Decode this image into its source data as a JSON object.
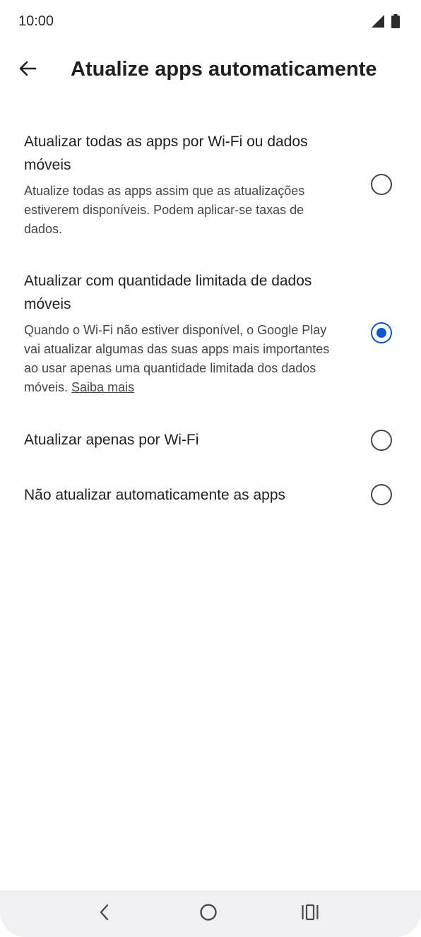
{
  "status_bar": {
    "time": "10:00",
    "icons": [
      "signal-icon",
      "battery-icon"
    ]
  },
  "app_bar": {
    "back_icon": "arrow-left-icon",
    "title": "Atualize apps automaticamente"
  },
  "options": [
    {
      "title": "Atualizar todas as apps por Wi-Fi ou dados móveis",
      "description": "Atualize todas as apps assim que as atualizações estiverem disponíveis. Podem aplicar-se taxas de dados.",
      "selected": false
    },
    {
      "title": "Atualizar com quantidade limitada de dados móveis",
      "description": "Quando o Wi-Fi não estiver disponível, o Google Play vai atualizar algumas das suas apps mais importantes ao usar apenas uma quantidade limitada dos dados móveis.",
      "link": "Saiba mais",
      "selected": true
    },
    {
      "title": "Atualizar apenas por Wi-Fi",
      "selected": false
    },
    {
      "title": "Não atualizar automaticamente as apps",
      "selected": false
    }
  ],
  "colors": {
    "accent": "#0b57d0",
    "text": "#1f1f1f",
    "secondary_text": "#444746",
    "nav_background": "#f0f0f3"
  },
  "nav_bar": {
    "icons": [
      "back-chevron-icon",
      "home-circle-icon",
      "recents-icon"
    ]
  }
}
